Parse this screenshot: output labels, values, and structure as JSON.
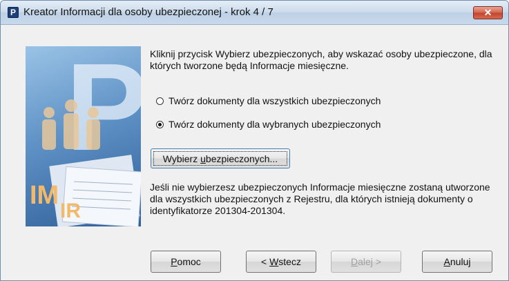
{
  "window": {
    "title": "Kreator Informacji dla osoby ubezpieczonej  - krok 4 / 7",
    "app_icon_letter": "P",
    "close_label": "✕"
  },
  "illustration": {
    "badge_im": "IM",
    "badge_ir": "IR",
    "big_letter": "P"
  },
  "intro_text": "Kliknij przycisk Wybierz ubezpieczonych, aby wskazać osoby ubezpieczone, dla których tworzone będą Informacje miesięczne.",
  "options": [
    {
      "label": "Twórz dokumenty dla wszystkich ubezpieczonych",
      "checked": false
    },
    {
      "label": "Twórz dokumenty dla wybranych ubezpieczonych",
      "checked": true
    }
  ],
  "select_button": {
    "pre": "Wybierz ",
    "accel": "u",
    "post": "bezpieczonych..."
  },
  "note_text": "Jeśli nie wybierzesz ubezpieczonych Informacje miesięczne zostaną utworzone dla wszystkich ubezpieczonych z Rejestru, dla których istnieją dokumenty o identyfikatorze  201304-201304.",
  "buttons": {
    "help": {
      "accel": "P",
      "rest": "omoc"
    },
    "back": {
      "pre": "< ",
      "accel": "W",
      "rest": "stecz"
    },
    "next": {
      "accel": "D",
      "rest": "alej >"
    },
    "cancel": {
      "accel": "A",
      "rest": "nuluj"
    }
  }
}
